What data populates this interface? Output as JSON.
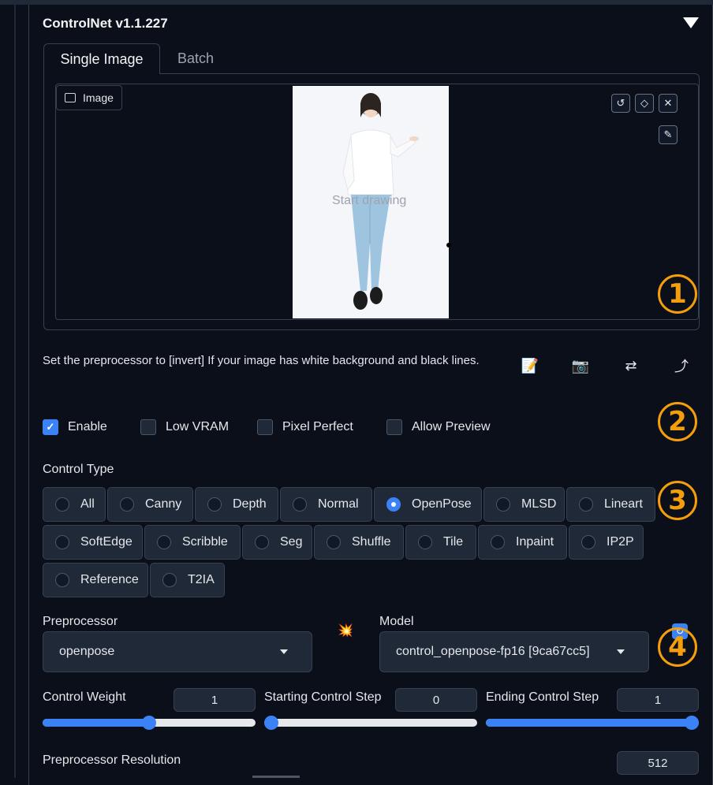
{
  "panel": {
    "title": "ControlNet v1.1.227",
    "tabs": [
      {
        "label": "Single Image"
      },
      {
        "label": "Batch"
      }
    ]
  },
  "image_area": {
    "label": "Image",
    "overlay_text": "Start drawing",
    "buttons": [
      "undo-icon",
      "eraser-icon",
      "close-icon",
      "brush-icon"
    ]
  },
  "hint": "Set the preprocessor to [invert] If your image has white background and black lines.",
  "toolbar_icons": {
    "memo": "📝",
    "camera": "📷",
    "swap": "⇄",
    "send": "⤴"
  },
  "options": {
    "enable": {
      "label": "Enable",
      "checked": true
    },
    "low_vram": {
      "label": "Low VRAM",
      "checked": false
    },
    "pixel_perfect": {
      "label": "Pixel Perfect",
      "checked": false
    },
    "allow_preview": {
      "label": "Allow Preview",
      "checked": false
    }
  },
  "control_type": {
    "label": "Control Type",
    "selected": "OpenPose",
    "items": [
      {
        "label": "All"
      },
      {
        "label": "Canny"
      },
      {
        "label": "Depth"
      },
      {
        "label": "Normal"
      },
      {
        "label": "OpenPose"
      },
      {
        "label": "MLSD"
      },
      {
        "label": "Lineart"
      },
      {
        "label": "SoftEdge"
      },
      {
        "label": "Scribble"
      },
      {
        "label": "Seg"
      },
      {
        "label": "Shuffle"
      },
      {
        "label": "Tile"
      },
      {
        "label": "Inpaint"
      },
      {
        "label": "IP2P"
      },
      {
        "label": "Reference"
      },
      {
        "label": "T2IA"
      }
    ]
  },
  "preprocessor": {
    "label": "Preprocessor",
    "value": "openpose"
  },
  "run_icon": "💥",
  "model": {
    "label": "Model",
    "value": "control_openpose-fp16 [9ca67cc5]"
  },
  "sliders": {
    "control_weight": {
      "label": "Control Weight",
      "value": "1",
      "fraction": 0.5
    },
    "starting_step": {
      "label": "Starting Control Step",
      "value": "0",
      "fraction": 0.0
    },
    "ending_step": {
      "label": "Ending Control Step",
      "value": "1",
      "fraction": 1.0
    }
  },
  "resolution": {
    "label": "Preprocessor Resolution",
    "value": "512"
  },
  "annotations": {
    "badge1": "1",
    "badge2": "2",
    "badge3": "3",
    "badge4": "4",
    "color": "#f59e0b"
  },
  "accent_color": "#3b82f6"
}
